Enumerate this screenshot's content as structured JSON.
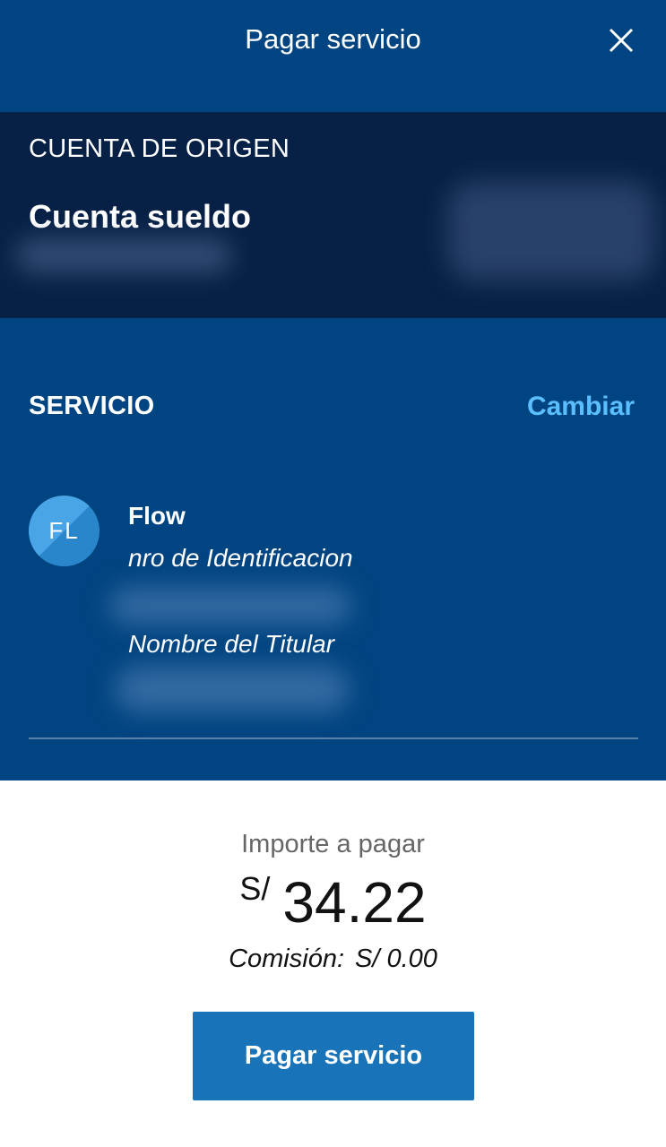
{
  "header": {
    "title": "Pagar servicio",
    "close_icon": "close-icon"
  },
  "origin": {
    "label": "CUENTA DE ORIGEN",
    "account_name": "Cuenta sueldo"
  },
  "service": {
    "label": "SERVICIO",
    "change_label": "Cambiar",
    "avatar_initials": "FL",
    "provider_name": "Flow",
    "id_label": "nro de Identificacion",
    "holder_label": "Nombre del Titular"
  },
  "payment": {
    "amount_label": "Importe a pagar",
    "currency": "S/",
    "amount": "34.22",
    "commission_label": "Comisión:",
    "commission_value": "S/ 0.00",
    "button_label": "Pagar servicio"
  },
  "colors": {
    "header_bg": "#004481",
    "origin_bg": "#072146",
    "link": "#5bbeff",
    "button_bg": "#1973b8"
  }
}
